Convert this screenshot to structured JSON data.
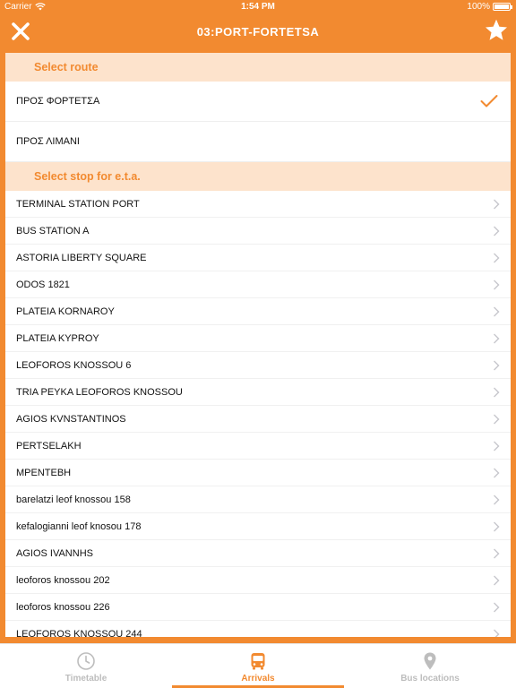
{
  "status": {
    "carrier": "Carrier",
    "time": "1:54 PM",
    "battery": "100%"
  },
  "header": {
    "title": "03:PORT-FORTETSA"
  },
  "routes": {
    "header": "Select route",
    "items": [
      {
        "label": "ΠΡΟΣ ΦΟΡΤΕΤΣΑ",
        "selected": true
      },
      {
        "label": "ΠΡΟΣ ΛΙΜΑΝΙ",
        "selected": false
      }
    ]
  },
  "stops": {
    "header": "Select stop for e.t.a.",
    "items": [
      "TERMINAL STATION PORT",
      "BUS STATION A",
      "ASTORIA LIBERTY SQUARE",
      "ODOS 1821",
      "PLATEIA KORNAROY",
      "PLATEIA KYPROY",
      "LEOFOROS KNOSSOU 6",
      "TRIA PEYKA LEOFOROS KNOSSOU",
      "AGIOS KVNSTANTINOS",
      "PERTSELAKH",
      "ΜΡΕΝΤΕΒΗ",
      "barelatzi leof knossou 158",
      "kefalogianni leof knosou 178",
      "AGIOS IVANNHS",
      "leoforos knossou 202",
      "leoforos knossou 226",
      "LEOFOROS KNOSSOU 244"
    ]
  },
  "tabs": [
    {
      "label": "Timetable",
      "icon": "clock-icon",
      "active": false
    },
    {
      "label": "Arrivals",
      "icon": "bus-icon",
      "active": true
    },
    {
      "label": "Bus locations",
      "icon": "map-pin-icon",
      "active": false
    }
  ],
  "colors": {
    "accent": "#f28a30",
    "section_bg": "#fde3cc",
    "inactive": "#bdbdbd"
  }
}
